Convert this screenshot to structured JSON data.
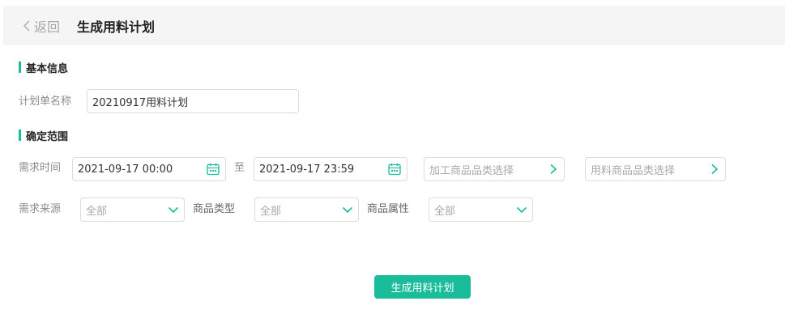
{
  "header": {
    "back_label": "返回",
    "title": "生成用料计划"
  },
  "basic_info": {
    "section_title": "基本信息",
    "plan_name_label": "计划单名称",
    "plan_name_value": "20210917用料计划"
  },
  "scope": {
    "section_title": "确定范围",
    "demand_time_label": "需求时间",
    "start_time": "2021-09-17 00:00",
    "to_label": "至",
    "end_time": "2021-09-17 23:59",
    "processed_category_placeholder": "加工商品品类选择",
    "material_category_placeholder": "用料商品品类选择",
    "demand_source_label": "需求来源",
    "demand_source_value": "全部",
    "product_type_label": "商品类型",
    "product_type_value": "全部",
    "product_attr_label": "商品属性",
    "product_attr_value": "全部"
  },
  "actions": {
    "generate_label": "生成用料计划"
  },
  "colors": {
    "accent": "#19bd9b",
    "header_bg": "#f5f5f5",
    "border": "#dcdcdc"
  }
}
